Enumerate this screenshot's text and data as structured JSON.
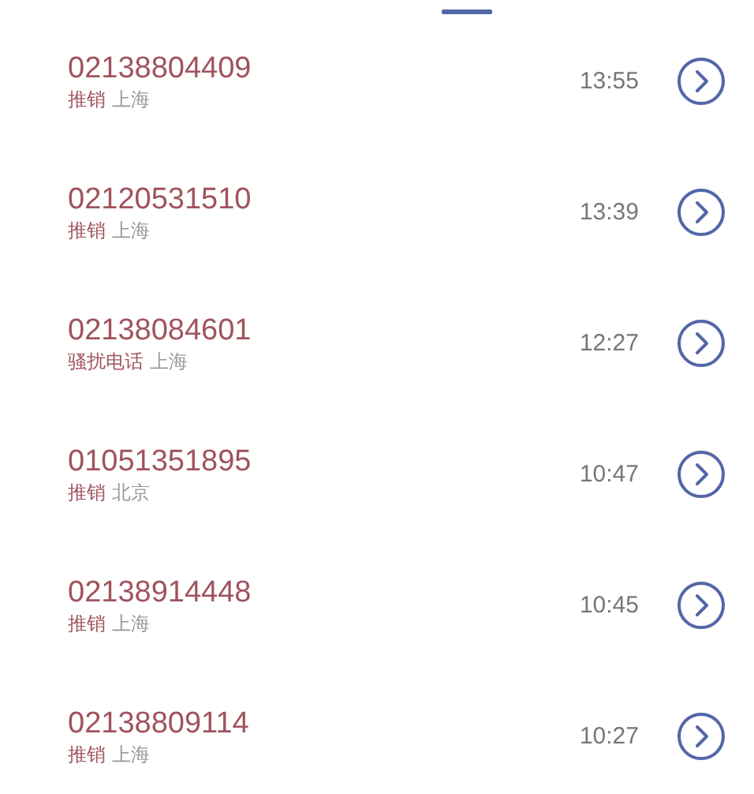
{
  "calls": [
    {
      "number": "02138804409",
      "tag": "推销",
      "location": "上海",
      "time": "13:55"
    },
    {
      "number": "02120531510",
      "tag": "推销",
      "location": "上海",
      "time": "13:39"
    },
    {
      "number": "02138084601",
      "tag": "骚扰电话",
      "location": "上海",
      "time": "12:27"
    },
    {
      "number": "01051351895",
      "tag": "推销",
      "location": "北京",
      "time": "10:47"
    },
    {
      "number": "02138914448",
      "tag": "推销",
      "location": "上海",
      "time": "10:45"
    },
    {
      "number": "02138809114",
      "tag": "推销",
      "location": "上海",
      "time": "10:27"
    }
  ]
}
